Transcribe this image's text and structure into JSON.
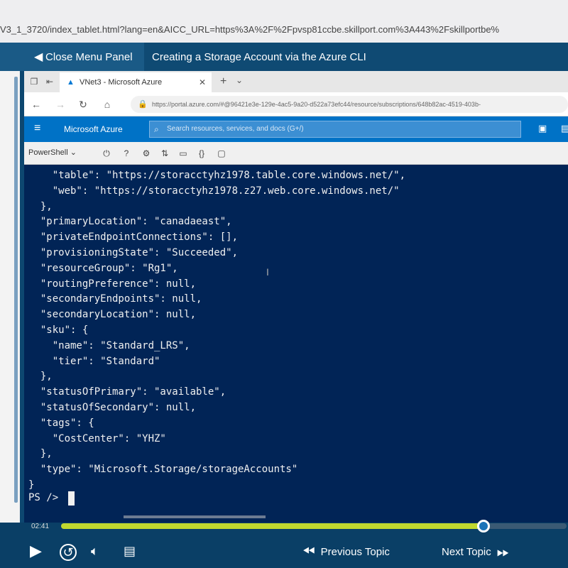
{
  "address_strip": {
    "url": "V3_1_3720/index_tablet.html?lang=en&AICC_URL=https%3A%2F%2Fpvsp81ccbe.skillport.com%3A443%2Fskillportbe%"
  },
  "header": {
    "close_menu_label": "Close Menu Panel",
    "topic_title": "Creating a Storage Account via the Azure CLI"
  },
  "browser": {
    "tab_title": "VNet3 - Microsoft Azure",
    "address": "https://portal.azure.com/#@96421e3e-129e-4ac5-9a20-d522a73efc44/resource/subscriptions/648b82ac-4519-403b-",
    "azure_brand": "Microsoft Azure",
    "search_placeholder": "Search resources, services, and docs (G+/)"
  },
  "shell": {
    "selector": "PowerShell",
    "lines": [
      "    \"table\": \"https://storacctyhz1978.table.core.windows.net/\",",
      "    \"web\": \"https://storacctyhz1978.z27.web.core.windows.net/\"",
      "  },",
      "  \"primaryLocation\": \"canadaeast\",",
      "  \"privateEndpointConnections\": [],",
      "  \"provisioningState\": \"Succeeded\",",
      "  \"resourceGroup\": \"Rg1\",",
      "  \"routingPreference\": null,",
      "  \"secondaryEndpoints\": null,",
      "  \"secondaryLocation\": null,",
      "  \"sku\": {",
      "    \"name\": \"Standard_LRS\",",
      "    \"tier\": \"Standard\"",
      "  },",
      "  \"statusOfPrimary\": \"available\",",
      "  \"statusOfSecondary\": null,",
      "  \"tags\": {",
      "    \"CostCenter\": \"YHZ\"",
      "  },",
      "  \"type\": \"Microsoft.Storage/storageAccounts\"",
      "}"
    ],
    "prompt": "PS />"
  },
  "player": {
    "elapsed": "02:41",
    "progress_fraction": 0.835,
    "previous_label": "Previous Topic",
    "next_label": "Next Topic"
  },
  "colors": {
    "terminal_bg": "#012456",
    "azure_blue": "#0072c6",
    "progress_fill": "#c1d82f"
  },
  "icons": [
    "back-arrow-icon",
    "forward-arrow-icon",
    "refresh-icon",
    "home-icon",
    "lock-icon",
    "hamburger-icon",
    "search-icon",
    "play-icon",
    "replay-10-icon",
    "volume-icon",
    "transcript-icon",
    "rewind-icon",
    "fast-forward-icon"
  ]
}
